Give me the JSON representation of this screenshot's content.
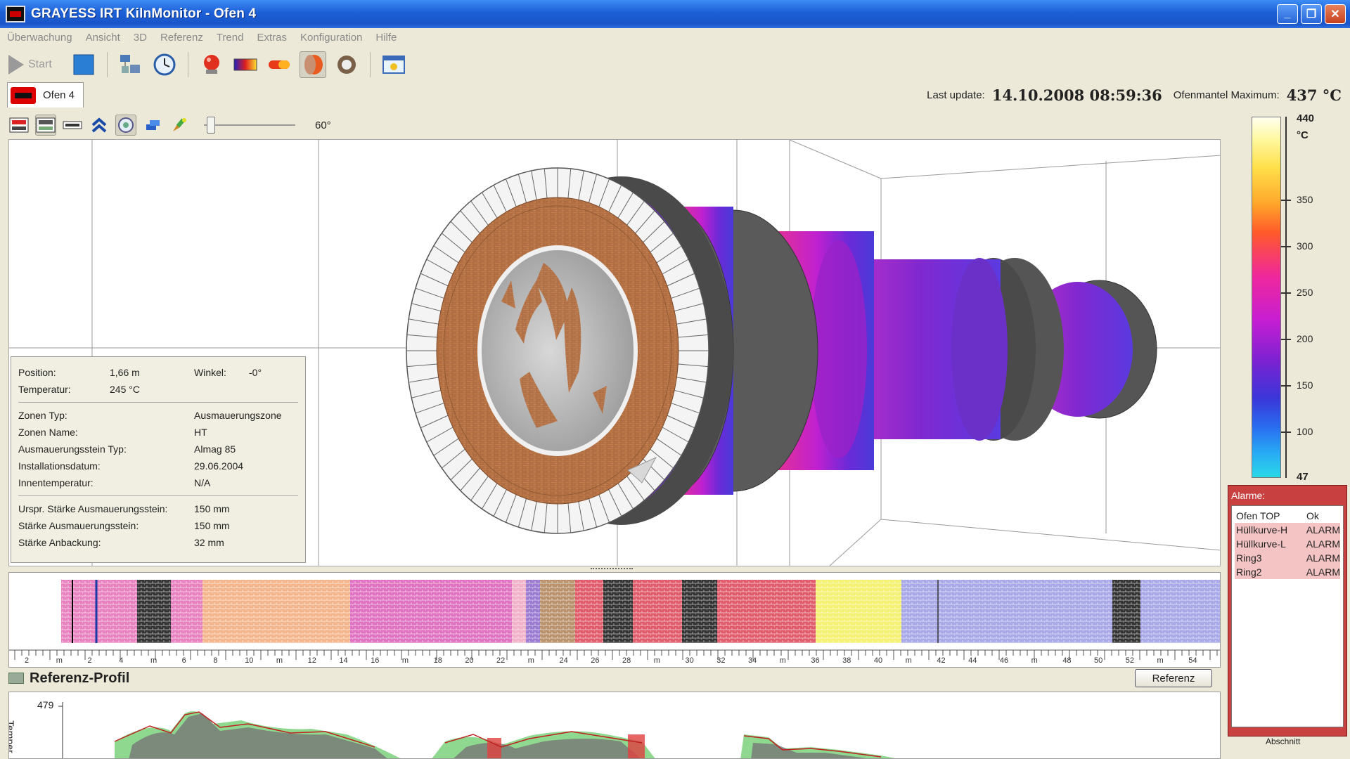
{
  "window": {
    "title": "GRAYESS IRT KilnMonitor - Ofen 4",
    "minimize": "_",
    "maximize": "❐",
    "close": "✕"
  },
  "menu": [
    "Überwachung",
    "Ansicht",
    "3D",
    "Referenz",
    "Trend",
    "Extras",
    "Konfiguration",
    "Hilfe"
  ],
  "toolbar": {
    "start_label": "Start"
  },
  "tab": {
    "label": "Ofen 4"
  },
  "status": {
    "last_update_label": "Last update:",
    "last_update_value": "14.10.2008 08:59:36",
    "max_label": "Ofenmantel Maximum:",
    "max_value": "437 °C"
  },
  "view": {
    "angle": "60°"
  },
  "info": {
    "position_label": "Position:",
    "position_value": "1,66 m",
    "winkel_label": "Winkel:",
    "winkel_value": "-0°",
    "temperatur_label": "Temperatur:",
    "temperatur_value": "245 °C",
    "rows1": [
      {
        "k": "Zonen Typ:",
        "v": "Ausmauerungszone"
      },
      {
        "k": "Zonen Name:",
        "v": "HT"
      },
      {
        "k": "Ausmauerungsstein Typ:",
        "v": "Almag 85"
      },
      {
        "k": "Installationsdatum:",
        "v": "29.06.2004"
      },
      {
        "k": "Innentemperatur:",
        "v": "N/A"
      }
    ],
    "rows2": [
      {
        "k": "Urspr. Stärke Ausmauerungsstein:",
        "v": "150 mm"
      },
      {
        "k": "Stärke Ausmauerungsstein:",
        "v": "150 mm"
      },
      {
        "k": "Stärke Anbackung:",
        "v": "32 mm"
      }
    ]
  },
  "scale": {
    "max": "440",
    "unit": "°C",
    "min": "47",
    "ticks": [
      "350",
      "300",
      "250",
      "200",
      "150",
      "100"
    ]
  },
  "alarms": {
    "title": "Alarme:",
    "items": [
      {
        "name": "Ofen TOP",
        "status": "Ok",
        "state": "ok"
      },
      {
        "name": "Hüllkurve-H",
        "status": "ALARM",
        "state": "alarm"
      },
      {
        "name": "Hüllkurve-L",
        "status": "ALARM",
        "state": "alarm"
      },
      {
        "name": "Ring3",
        "status": "ALARM",
        "state": "alarm"
      },
      {
        "name": "Ring2",
        "status": "ALARM",
        "state": "alarm"
      }
    ],
    "abschnitt": "Abschnitt"
  },
  "strip": {
    "ruler_labels": [
      "2",
      "m",
      "2",
      "4",
      "m",
      "6",
      "8",
      "10",
      "m",
      "12",
      "14",
      "16",
      "m",
      "18",
      "20",
      "22",
      "m",
      "24",
      "26",
      "28",
      "m",
      "30",
      "32",
      "34",
      "m",
      "36",
      "38",
      "40",
      "m",
      "42",
      "44",
      "46",
      "m",
      "48",
      "50",
      "52",
      "m",
      "54"
    ]
  },
  "reference": {
    "title": "Referenz-Profil",
    "button": "Referenz",
    "ymax": "479",
    "ylabel": "Temper"
  }
}
